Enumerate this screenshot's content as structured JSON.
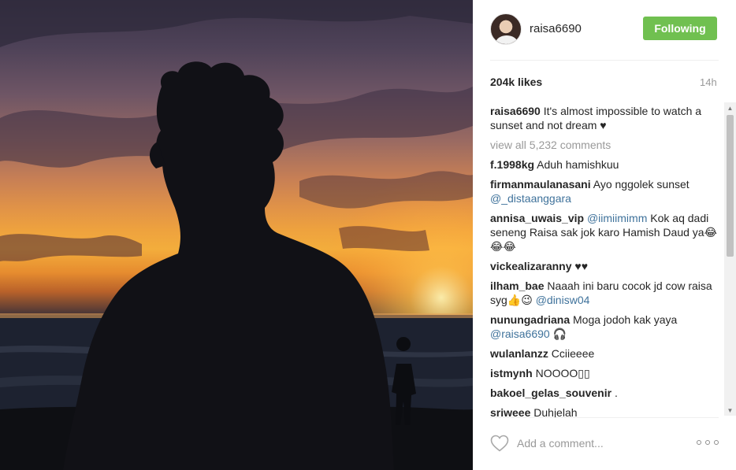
{
  "post": {
    "username": "raisa6690",
    "follow_label": "Following",
    "likes": "204k likes",
    "time": "14h",
    "caption_user": "raisa6690",
    "caption_text": "It's almost impossible to watch a sunset and not dream ♥",
    "view_all": "view all 5,232 comments"
  },
  "comments": [
    {
      "user": "f.1998kg",
      "text": "Aduh hamishkuu",
      "mention": ""
    },
    {
      "user": "firmanmaulanasani",
      "text": "Ayo nggolek sunset",
      "mention": "@_distaanggara"
    },
    {
      "user": "annisa_uwais_vip",
      "mention_first": "@iimiimimm",
      "text": "Kok aq dadi seneng Raisa sak jok karo Hamish Daud ya😂😂😂"
    },
    {
      "user": "vickealizaranny",
      "text": "♥♥",
      "mention": ""
    },
    {
      "user": "ilham_bae",
      "text": "Naaah ini baru cocok jd cow raisa syg👍😉",
      "mention": "@dinisw04"
    },
    {
      "user": "nunungadriana",
      "text": "Moga jodoh kak yaya",
      "mention": "@raisa6690",
      "tail": "🎧"
    },
    {
      "user": "wulanlanzz",
      "text": "Cciieeee",
      "mention": ""
    },
    {
      "user": "istmynh",
      "text": "NOOOO▯▯",
      "mention": ""
    },
    {
      "user": "bakoel_gelas_souvenir",
      "text": ".",
      "mention": ""
    },
    {
      "user": "sriweee",
      "text": "Duhjelah",
      "mention": ""
    }
  ],
  "footer": {
    "comment_placeholder": "Add a comment..."
  },
  "icons": {
    "like": "heart-outline-icon",
    "more": "more-options-icon"
  },
  "colors": {
    "follow_button": "#70c050",
    "mention": "#3f729b",
    "muted": "#999999"
  }
}
